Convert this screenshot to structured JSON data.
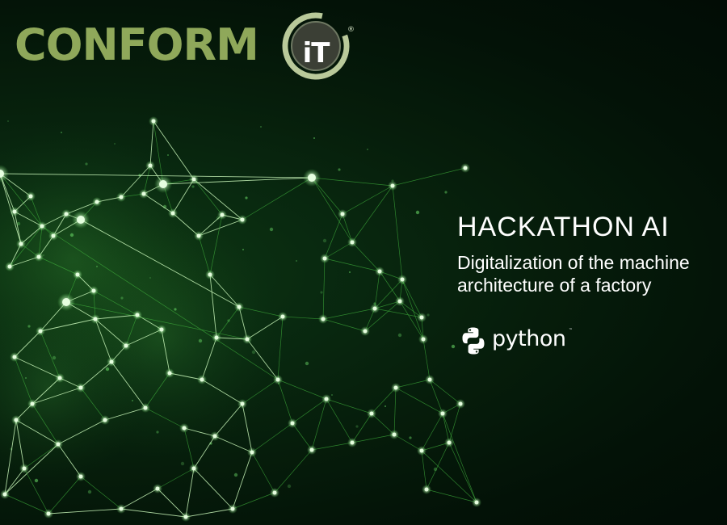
{
  "brand": {
    "logo_text": "CONFORM",
    "badge_text": "iT",
    "registered": "®",
    "green": "#8fa85a",
    "badge_ring": "#b9c99a",
    "badge_fill": "#3b3f35"
  },
  "hero": {
    "title": "HACKATHON AI",
    "subtitle": "Digitalization of the machine architecture of a factory"
  },
  "tech": {
    "name": "python",
    "tm": "™",
    "icon": "python-logo-icon"
  },
  "colors": {
    "node": "#e6ffe0",
    "edge_bright": "#c8f5b8",
    "edge_green": "#3fae3c",
    "glow": "#6ee06a"
  }
}
